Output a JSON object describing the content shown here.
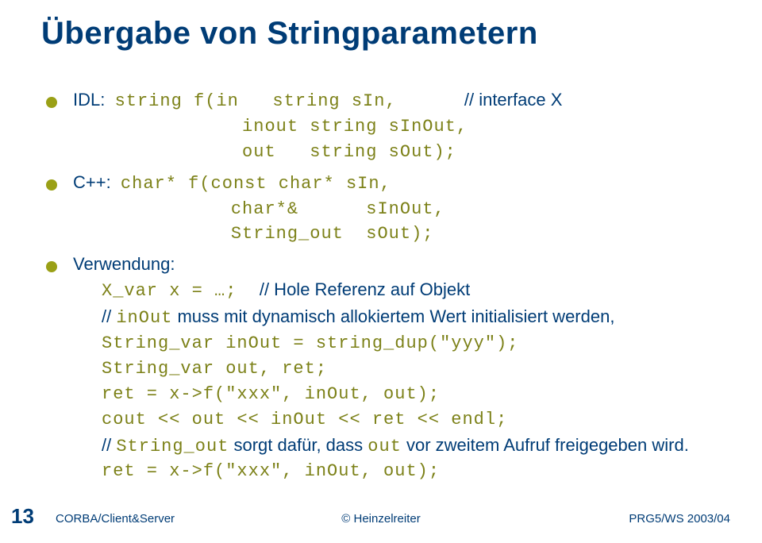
{
  "title": "Übergabe von Stringparametern",
  "b1_prefix": "IDL:  ",
  "b1_l1_code": "string f(in   string sIn,      ",
  "b1_l1_cmt": "// interface X",
  "b1_l2_code": "         inout string sInOut,",
  "b1_l3_code": "         out   string sOut);",
  "b2_prefix": "C++:  ",
  "b2_l1_code": "char* f(const char* sIn,",
  "b2_l2_code": "        char*&      sInOut,",
  "b2_l3_code": "        String_out  sOut);",
  "b3_label": "Verwendung:",
  "b3_l1_a": "X_var x = …;  ",
  "b3_l1_b": "// Hole Referenz auf Objekt",
  "b3_l2_a": "// ",
  "b3_l2_b": "inOut",
  "b3_l2_c": " muss mit dynamisch allokiertem Wert initialisiert werden,",
  "b3_l3": "String_var inOut = string_dup(\"yyy\");",
  "b3_l4": "String_var out, ret;",
  "b3_l5": "ret = x->f(\"xxx\", inOut, out);",
  "b3_l6": "cout << out << inOut << ret << endl;",
  "b3_l7_a": "// ",
  "b3_l7_b": "String_out",
  "b3_l7_c": " sorgt dafür, dass ",
  "b3_l7_d": "out",
  "b3_l7_e": " vor zweitem Aufruf freigegeben wird.",
  "b3_l8": "ret = x->f(\"xxx\", inOut, out);",
  "footer_page": "13",
  "footer_left": "CORBA/Client&Server",
  "footer_center": "© Heinzelreiter",
  "footer_right": "PRG5/WS 2003/04"
}
